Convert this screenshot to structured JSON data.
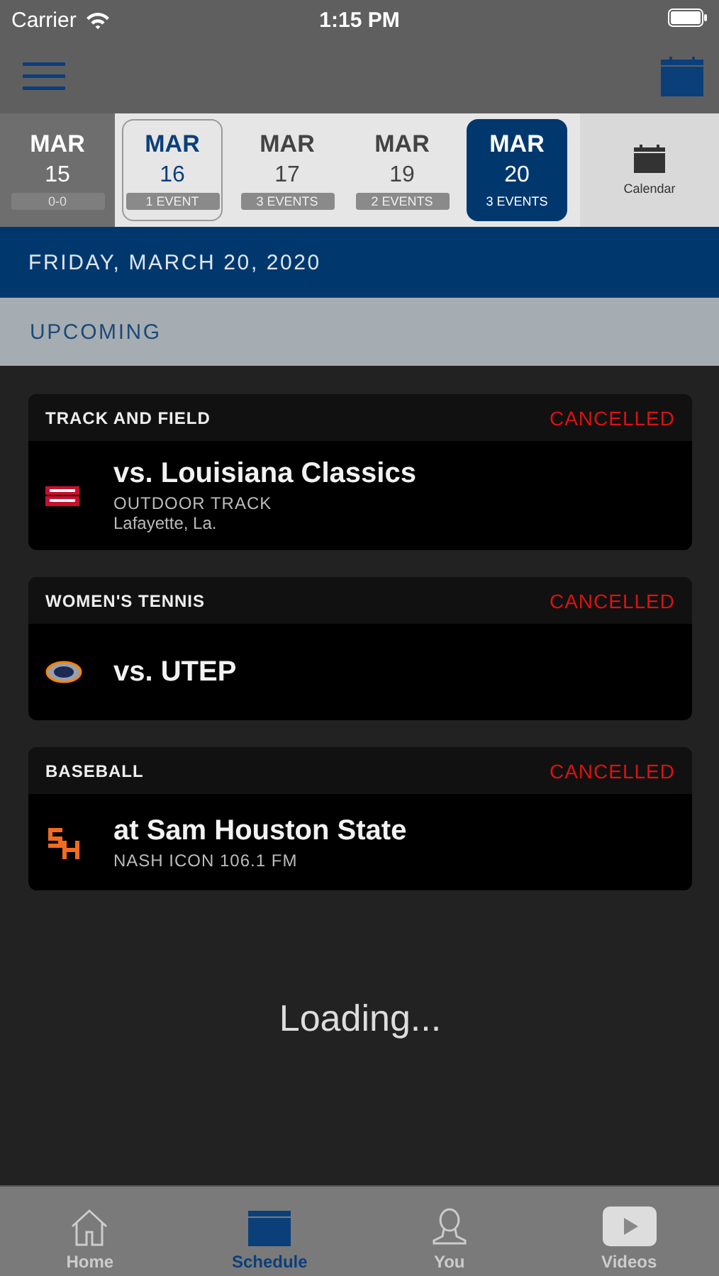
{
  "status_bar": {
    "carrier": "Carrier",
    "time": "1:15 PM"
  },
  "dates": [
    {
      "month": "MAR",
      "day": "15",
      "count": "0-0",
      "selected": false,
      "today": false,
      "past": true
    },
    {
      "month": "MAR",
      "day": "16",
      "count": "1 EVENT",
      "selected": false,
      "today": true,
      "past": false
    },
    {
      "month": "MAR",
      "day": "17",
      "count": "3 EVENTS",
      "selected": false,
      "today": false,
      "past": false
    },
    {
      "month": "MAR",
      "day": "19",
      "count": "2 EVENTS",
      "selected": false,
      "today": false,
      "past": false
    },
    {
      "month": "MAR",
      "day": "20",
      "count": "3 EVENTS",
      "selected": true,
      "today": false,
      "past": false
    }
  ],
  "calendar_button": "Calendar",
  "date_header": "FRIDAY, MARCH 20, 2020",
  "section": "UPCOMING",
  "events": [
    {
      "sport": "TRACK AND FIELD",
      "status": "CANCELLED",
      "title": "vs. Louisiana Classics",
      "lines": [
        "OUTDOOR TRACK",
        "Lafayette, La."
      ]
    },
    {
      "sport": "WOMEN'S TENNIS",
      "status": "CANCELLED",
      "title": "vs. UTEP"
    },
    {
      "sport": "BASEBALL",
      "status": "CANCELLED",
      "title": "at Sam Houston State",
      "lines": [
        "NASH ICON 106.1 FM"
      ]
    }
  ],
  "loading": "Loading...",
  "tabs": [
    {
      "label": "Home",
      "selected": false
    },
    {
      "label": "Schedule",
      "selected": true
    },
    {
      "label": "You",
      "selected": false
    },
    {
      "label": "Videos",
      "selected": false
    }
  ]
}
